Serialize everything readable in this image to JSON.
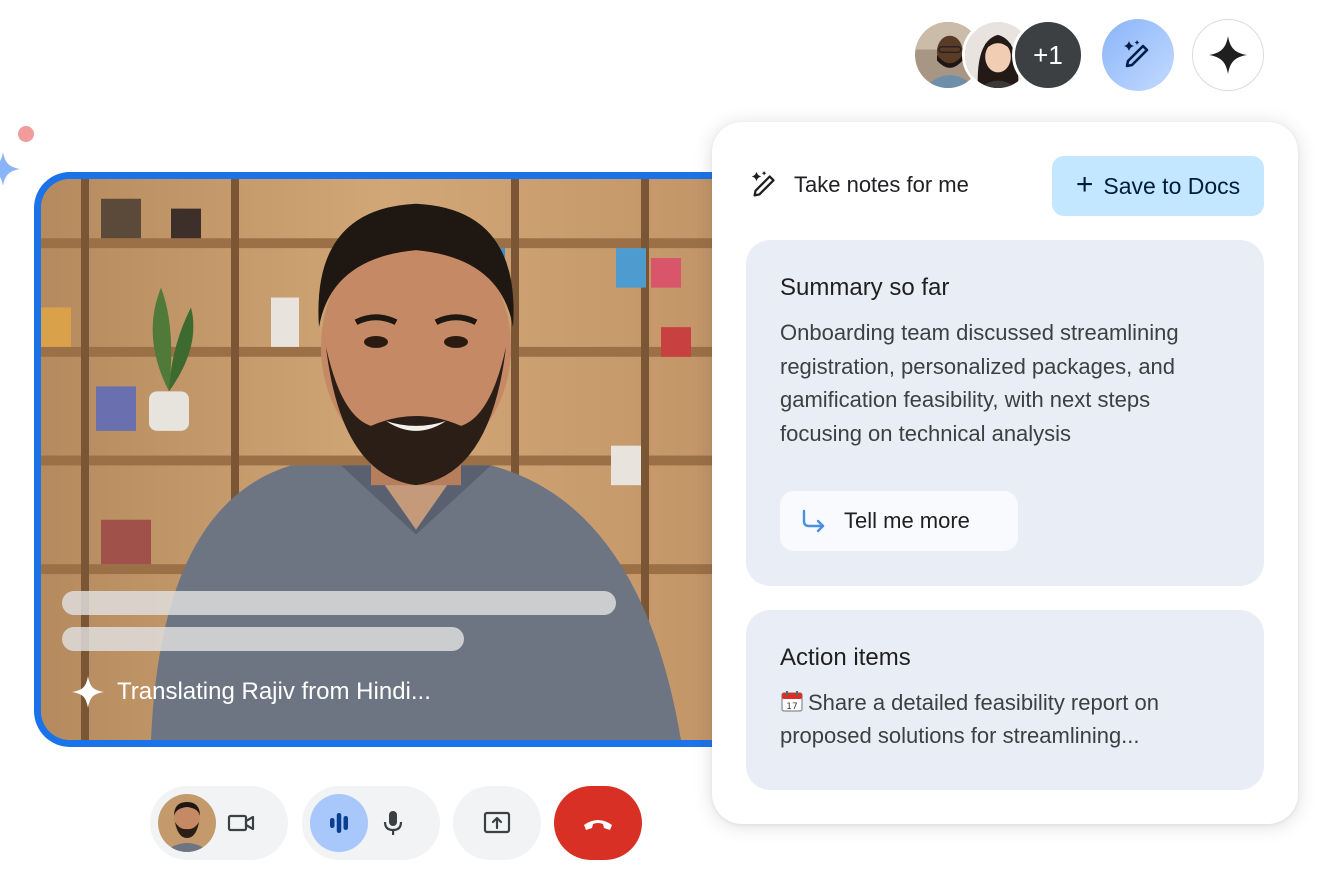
{
  "participants": {
    "overflow_count": "+1"
  },
  "video": {
    "translation_status": "Translating Rajiv from Hindi..."
  },
  "panel": {
    "title": "Take notes for me",
    "save_button": "Save to Docs",
    "summary": {
      "title": "Summary so far",
      "body": "Onboarding team discussed streamlining registration, personalized packages, and gamification feasibility, with next steps focusing on technical analysis",
      "more_button": "Tell me more"
    },
    "action_items": {
      "title": "Action items",
      "body": "Share a detailed feasibility report on proposed solutions for streamlining..."
    }
  },
  "icons": {
    "notes": "pencil-sparkle-icon",
    "gemini": "gemini-sparkle-icon",
    "translate": "sparkle-icon",
    "tell_more": "arrow-return-icon",
    "calendar": "calendar-icon",
    "camera": "video-camera-icon",
    "speaking": "audio-level-icon",
    "mic": "microphone-icon",
    "present": "present-screen-icon",
    "end_call": "end-call-icon"
  },
  "colors": {
    "accent_blue": "#1a73e8",
    "save_button_bg": "#c2e7ff",
    "card_bg": "#e9eef6",
    "end_call_red": "#d93025",
    "speaking_bg": "#a8c7fa"
  }
}
